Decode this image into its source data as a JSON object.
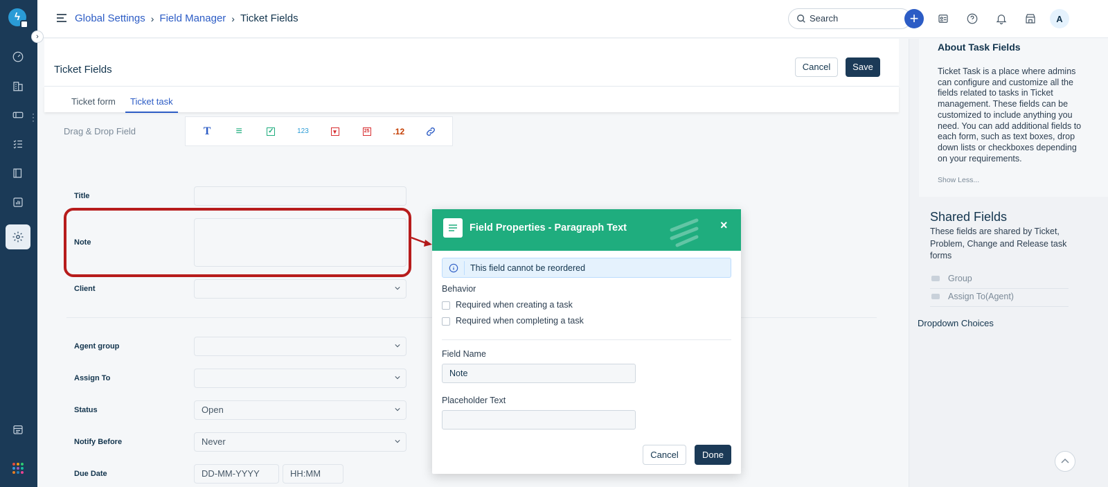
{
  "topbar": {
    "breadcrumb": [
      "Global Settings",
      "Field Manager",
      "Ticket Fields"
    ],
    "search_placeholder": "Search",
    "plus_label": "+",
    "avatar_initial": "A"
  },
  "sidebar": {
    "logo": "ϟ",
    "expand": "›",
    "icons": [
      "dashboard-icon",
      "building-icon",
      "ticket-icon",
      "tasks-icon",
      "book-icon",
      "reports-icon",
      "settings-icon",
      "calendar-icon",
      "apps-icon"
    ]
  },
  "header": {
    "title": "Ticket Fields",
    "cancel_label": "Cancel",
    "save_label": "Save"
  },
  "tabs": [
    {
      "label": "Ticket form",
      "active": false
    },
    {
      "label": "Ticket task",
      "active": true
    }
  ],
  "dragdrop": {
    "label": "Drag & Drop Field",
    "tools": [
      {
        "name": "single-line-text-icon",
        "glyph": "T",
        "color": "#2c5cc5"
      },
      {
        "name": "paragraph-text-icon",
        "glyph": "≡",
        "color": "#1fad7e"
      },
      {
        "name": "checkbox-icon",
        "glyph": "✓",
        "color": "#1fad7e"
      },
      {
        "name": "number-icon",
        "glyph": "123",
        "color": "#2a9bd6"
      },
      {
        "name": "dropdown-icon",
        "glyph": "▾",
        "color": "#d72d30"
      },
      {
        "name": "date-icon",
        "glyph": "25",
        "color": "#d72d30"
      },
      {
        "name": "decimal-icon",
        "glyph": ".12",
        "color": "#c43d00"
      },
      {
        "name": "link-icon",
        "glyph": "🔗",
        "color": "#2c5cc5"
      }
    ]
  },
  "form": {
    "title_label": "Title",
    "note_label": "Note",
    "client_label": "Client",
    "agent_group_label": "Agent group",
    "assign_to_label": "Assign To",
    "status_label": "Status",
    "status_value": "Open",
    "notify_label": "Notify Before",
    "notify_value": "Never",
    "due_date_label": "Due Date",
    "due_date_placeholder": "DD-MM-YYYY",
    "due_time_placeholder": "HH:MM"
  },
  "modal": {
    "title": "Field Properties - Paragraph Text",
    "close": "×",
    "info": "This field cannot be reordered",
    "behavior_label": "Behavior",
    "check1": "Required when creating a task",
    "check2": "Required when completing a task",
    "field_name_label": "Field Name",
    "field_name_value": "Note",
    "placeholder_label": "Placeholder Text",
    "placeholder_value": "",
    "cancel_label": "Cancel",
    "done_label": "Done"
  },
  "right_panel": {
    "about_title": "About Task Fields",
    "about_text": "Ticket Task is a place where admins can configure and customize all the fields related to tasks in Ticket management. These fields can be customized to include anything you need. You can add additional fields to each form, such as text boxes, drop down lists or checkboxes depending on your requirements.",
    "show_less": "Show Less...",
    "shared_title": "Shared Fields",
    "shared_text": "These fields are shared by Ticket, Problem, Change and Release task forms",
    "shared_items": [
      "Group",
      "Assign To(Agent)"
    ],
    "dropdown_choices": "Dropdown Choices"
  },
  "colors": {
    "nav_bg": "#1b3a57",
    "accent": "#2c5cc5",
    "modal_header": "#1fad7e",
    "highlight": "#b71c1c"
  }
}
